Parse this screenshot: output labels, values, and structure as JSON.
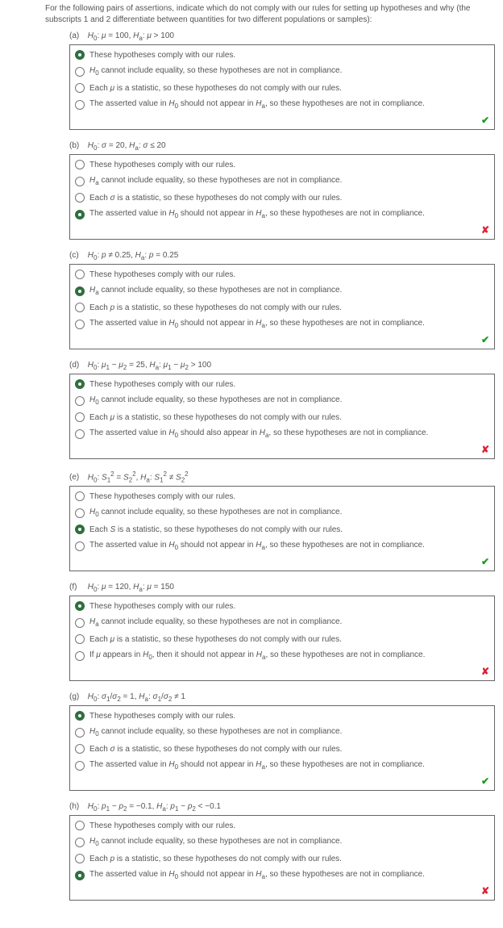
{
  "intro": "For the following pairs of assertions, indicate which do not comply with our rules for setting up hypotheses and why (the subscripts 1 and 2 differentiate between quantities for two different populations or samples):",
  "questions": [
    {
      "part": "(a)",
      "header_html": "<i>H</i><sub>0</sub>: <i>μ</i> = 100, <i>H</i><sub>a</sub>: <i>μ</i> &gt; 100",
      "selected": 0,
      "status": "ok",
      "options": [
        "These hypotheses comply with our rules.",
        "<i>H</i><sub>0</sub> cannot include equality, so these hypotheses are not in compliance.",
        "Each <i>μ</i> is a statistic, so these hypotheses do not comply with our rules.",
        "The asserted value in <i>H</i><sub>0</sub> should not appear in <i>H</i><sub>a</sub>, so these hypotheses are not in compliance."
      ]
    },
    {
      "part": "(b)",
      "header_html": "<i>H</i><sub>0</sub>: <i>σ</i> = 20, <i>H</i><sub>a</sub>: <i>σ</i> ≤ 20",
      "selected": 3,
      "status": "bad",
      "options": [
        "These hypotheses comply with our rules.",
        "<i>H</i><sub>a</sub> cannot include equality, so these hypotheses are not in compliance.",
        "Each <i>σ</i> is a statistic, so these hypotheses do not comply with our rules.",
        "The asserted value in <i>H</i><sub>0</sub> should not appear in <i>H</i><sub>a</sub>, so these hypotheses are not in compliance."
      ]
    },
    {
      "part": "(c)",
      "header_html": "<i>H</i><sub>0</sub>: <i>p</i> ≠ 0.25, <i>H</i><sub>a</sub>: <i>p</i> = 0.25",
      "selected": 1,
      "status": "ok",
      "options": [
        "These hypotheses comply with our rules.",
        "<i>H</i><sub>a</sub> cannot include equality, so these hypotheses are not in compliance.",
        "Each <i>p</i> is a statistic, so these hypotheses do not comply with our rules.",
        "The asserted value in <i>H</i><sub>0</sub> should not appear in <i>H</i><sub>a</sub>, so these hypotheses are not in compliance."
      ]
    },
    {
      "part": "(d)",
      "header_html": "<i>H</i><sub>0</sub>: <i>μ</i><sub>1</sub> − <i>μ</i><sub>2</sub> = 25, <i>H</i><sub>a</sub>: <i>μ</i><sub>1</sub> − <i>μ</i><sub>2</sub> &gt; 100",
      "selected": 0,
      "status": "bad",
      "options": [
        "These hypotheses comply with our rules.",
        "<i>H</i><sub>0</sub> cannot include equality, so these hypotheses are not in compliance.",
        "Each <i>μ</i> is a statistic, so these hypotheses do not comply with our rules.",
        "The asserted value in <i>H</i><sub>0</sub> should also appear in <i>H</i><sub>a</sub>, so these hypotheses are not in compliance."
      ]
    },
    {
      "part": "(e)",
      "header_html": "<i>H</i><sub>0</sub>: <i>S</i><sub>1</sub><sup>2</sup> = <i>S</i><sub>2</sub><sup>2</sup>, <i>H</i><sub>a</sub>: <i>S</i><sub>1</sub><sup>2</sup> ≠ <i>S</i><sub>2</sub><sup>2</sup>",
      "selected": 2,
      "status": "ok",
      "options": [
        "These hypotheses comply with our rules.",
        "<i>H</i><sub>0</sub> cannot include equality, so these hypotheses are not in compliance.",
        "Each <i>S</i> is a statistic, so these hypotheses do not comply with our rules.",
        "The asserted value in <i>H</i><sub>0</sub> should not appear in <i>H</i><sub>a</sub>, so these hypotheses are not in compliance."
      ]
    },
    {
      "part": "(f)",
      "header_html": "<i>H</i><sub>0</sub>: <i>μ</i> = 120, <i>H</i><sub>a</sub>: <i>μ</i> = 150",
      "selected": 0,
      "status": "bad",
      "options": [
        "These hypotheses comply with our rules.",
        "<i>H</i><sub>a</sub> cannot include equality, so these hypotheses are not in compliance.",
        "Each <i>μ</i> is a statistic, so these hypotheses do not comply with our rules.",
        "If <i>μ</i> appears in <i>H</i><sub>0</sub>, then it should not appear in <i>H</i><sub>a</sub>, so these hypotheses are not in compliance."
      ]
    },
    {
      "part": "(g)",
      "header_html": "<i>H</i><sub>0</sub>: <i>σ</i><sub>1</sub>/<i>σ</i><sub>2</sub> = 1, <i>H</i><sub>a</sub>: <i>σ</i><sub>1</sub>/<i>σ</i><sub>2</sub> ≠ 1",
      "selected": 0,
      "status": "ok",
      "options": [
        "These hypotheses comply with our rules.",
        "<i>H</i><sub>0</sub> cannot include equality, so these hypotheses are not in compliance.",
        "Each <i>σ</i> is a statistic, so these hypotheses do not comply with our rules.",
        "The asserted value in <i>H</i><sub>0</sub> should not appear in <i>H</i><sub>a</sub>, so these hypotheses are not in compliance."
      ]
    },
    {
      "part": "(h)",
      "header_html": "<i>H</i><sub>0</sub>: <i>p</i><sub>1</sub> − <i>p</i><sub>2</sub> = −0.1, <i>H</i><sub>a</sub>: <i>p</i><sub>1</sub> − <i>p</i><sub>2</sub> &lt; −0.1",
      "selected": 3,
      "status": "bad",
      "options": [
        "These hypotheses comply with our rules.",
        "<i>H</i><sub>0</sub> cannot include equality, so these hypotheses are not in compliance.",
        "Each <i>p</i> is a statistic, so these hypotheses do not comply with our rules.",
        "The asserted value in <i>H</i><sub>0</sub> should not appear in <i>H</i><sub>a</sub>, so these hypotheses are not in compliance."
      ]
    }
  ],
  "icons": {
    "ok": "✔",
    "bad": "✘"
  }
}
